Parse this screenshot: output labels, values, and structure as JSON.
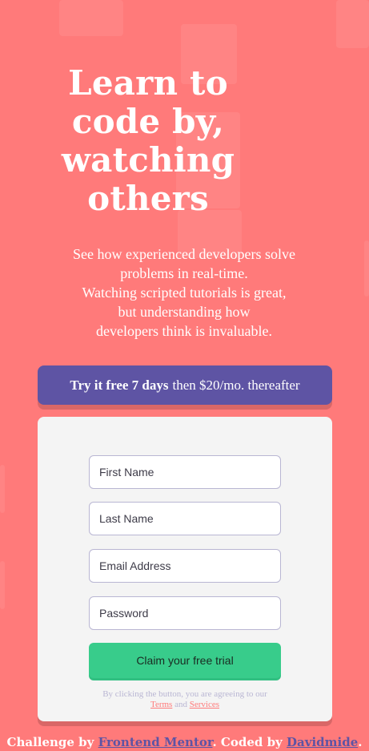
{
  "colors": {
    "background": "#ff7a7a",
    "promo": "#5e54a4",
    "submit": "#38cc8b",
    "card": "#f4f4f4"
  },
  "hero": {
    "title_lines": [
      "Learn to",
      "code by,",
      "watching",
      "others"
    ],
    "text_lines": [
      "See how experienced developers solve",
      "problems in real-time.",
      "Watching scripted tutorials is great,",
      "but understanding how",
      "developers think is invaluable."
    ]
  },
  "promo": {
    "bold": "Try it free 7 days",
    "rest": "then $20/mo. thereafter"
  },
  "form": {
    "first_name_placeholder": "First Name",
    "last_name_placeholder": "Last Name",
    "email_placeholder": "Email Address",
    "password_placeholder": "Password",
    "submit_label": "Claim your free trial",
    "terms_prefix": "By clicking the button, you are agreeing to our",
    "terms_link": "Terms",
    "terms_and": "and",
    "services_link": "Services"
  },
  "footer": {
    "prefix": "Challenge by",
    "mentor_link": "Frontend Mentor",
    "middle": ". Coded by",
    "author_link": "Davidmide",
    "suffix": "."
  }
}
